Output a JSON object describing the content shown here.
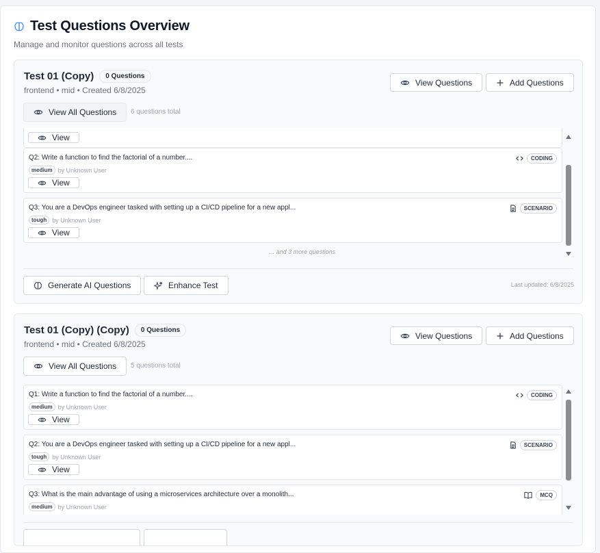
{
  "header": {
    "title": "Test Questions Overview",
    "subtitle": "Manage and monitor questions across all tests"
  },
  "buttons": {
    "view_questions": "View Questions",
    "add_questions": "Add Questions",
    "view_all": "View All Questions",
    "view": "View",
    "generate_ai": "Generate AI Questions",
    "enhance": "Enhance Test"
  },
  "tests": [
    {
      "title": "Test 01 (Copy)",
      "count_badge": "0 Questions",
      "meta": "frontend • mid • Created 6/8/2025",
      "total": "6 questions total",
      "questions": [
        {
          "text": "Q2: Write a function to find the factorial of a number....",
          "type": "CODING",
          "icon": "code-icon",
          "difficulty": "medium",
          "author": "by Unknown User"
        },
        {
          "text": "Q3: You are a DevOps engineer tasked with setting up a CI/CD pipeline for a new appl...",
          "type": "SCENARIO",
          "icon": "document-icon",
          "difficulty": "tough",
          "author": "by Unknown User"
        }
      ],
      "more": "... and 3 more questions",
      "updated": "Last updated: 6/8/2025"
    },
    {
      "title": "Test 01 (Copy) (Copy)",
      "count_badge": "0 Questions",
      "meta": "frontend • mid • Created 6/8/2025",
      "total": "5 questions total",
      "questions": [
        {
          "text": "Q1: Write a function to find the factorial of a number....",
          "type": "CODING",
          "icon": "code-icon",
          "difficulty": "medium",
          "author": "by Unknown User"
        },
        {
          "text": "Q2: You are a DevOps engineer tasked with setting up a CI/CD pipeline for a new appl...",
          "type": "SCENARIO",
          "icon": "document-icon",
          "difficulty": "tough",
          "author": "by Unknown User"
        },
        {
          "text": "Q3: What is the main advantage of using a microservices architecture over a monolith...",
          "type": "MCQ",
          "icon": "book-icon",
          "difficulty": "medium",
          "author": "by Unknown User"
        }
      ]
    }
  ],
  "colors": {
    "accent": "#3b82f6",
    "card_bg": "#f9fafb",
    "border": "#e5e7eb"
  }
}
